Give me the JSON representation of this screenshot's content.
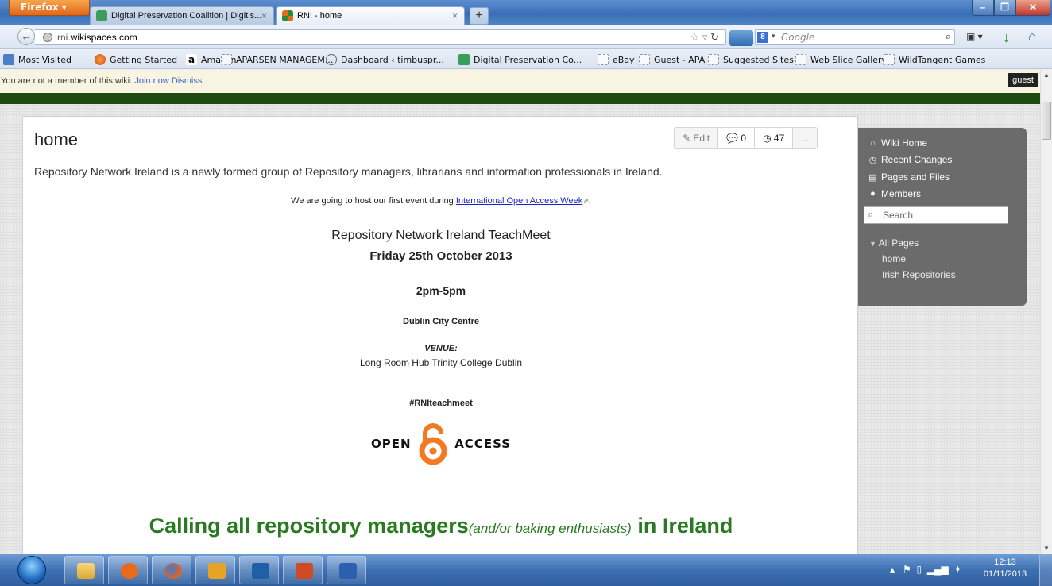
{
  "browser": {
    "menu_button": "Firefox",
    "tabs": [
      {
        "title": "Digital Preservation Coalition | Digitis...",
        "icon": "dpc-favicon-icon"
      },
      {
        "title": "RNI - home",
        "icon": "rni-favicon-icon"
      }
    ],
    "url_host": "rni.",
    "url_domain": "wikispaces.com",
    "search_placeholder": "Google",
    "search_engine_letter": "8",
    "bookmarks": [
      "Most Visited",
      "Getting Started",
      "Amazon",
      "APARSEN MANAGEM...",
      "Dashboard ‹ timbuspr...",
      "Digital Preservation Co...",
      "eBay",
      "Guest - APA",
      "Suggested Sites",
      "Web Slice Gallery",
      "WildTangent Games"
    ]
  },
  "notice": {
    "text": "You are not a member of this wiki.",
    "join": "Join now",
    "dismiss": "Dismiss",
    "user": "guest"
  },
  "page": {
    "title": "home",
    "actions": {
      "edit": "Edit",
      "comments": "0",
      "history": "47",
      "more": "..."
    },
    "intro": "Repository Network Ireland is a newly formed group of Repository managers, librarians and information professionals in Ireland.",
    "event_prefix": "We are going to host our first event during ",
    "event_link": "International Open Access Week",
    "event_suffix": ".",
    "event_title": "Repository Network Ireland TeachMeet",
    "event_date": "Friday 25th October 2013",
    "event_time": "2pm-5pm",
    "event_place": "Dublin City Centre",
    "venue_label": "VENUE:",
    "venue_name": "Long Room Hub Trinity College Dublin",
    "hashtag": "#RNIteachmeet",
    "logo_left": "OPEN",
    "logo_right": "ACCESS",
    "headline_a": "Calling all repository managers",
    "headline_b": "(and/or baking enthusiasts)",
    "headline_c": " in Ireland",
    "colors": {
      "headline": "#2a7a22",
      "green_bar": "#1e4a12",
      "oa_orange": "#f47920"
    }
  },
  "sidebar": {
    "items": [
      "Wiki Home",
      "Recent Changes",
      "Pages and Files",
      "Members"
    ],
    "search_placeholder": "Search",
    "all_pages": "All Pages",
    "pages": [
      "home",
      "Irish Repositories"
    ]
  },
  "taskbar": {
    "apps": [
      "file-explorer",
      "media-player",
      "firefox",
      "outlook",
      "twitter",
      "powerpoint",
      "word"
    ],
    "time": "12:13",
    "date": "01/11/2013"
  }
}
